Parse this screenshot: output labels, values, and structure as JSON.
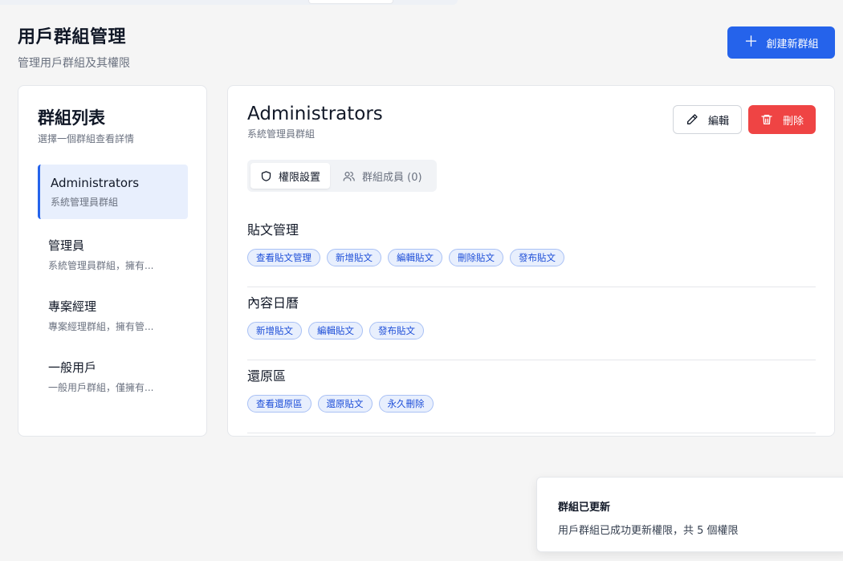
{
  "header": {
    "title": "用戶群組管理",
    "subtitle": "管理用戶群組及其權限",
    "create_label": "創建新群組"
  },
  "group_panel": {
    "title": "群組列表",
    "subtitle": "選擇一個群組查看詳情",
    "items": [
      {
        "name": "Administrators",
        "desc": "系統管理員群組",
        "active": true
      },
      {
        "name": "管理員",
        "desc": "系統管理員群組，擁有..."
      },
      {
        "name": "專案經理",
        "desc": "專案經理群組，擁有管..."
      },
      {
        "name": "一般用戶",
        "desc": "一般用戶群組，僅擁有..."
      }
    ]
  },
  "detail": {
    "title": "Administrators",
    "subtitle": "系統管理員群組",
    "edit_label": "編輯",
    "delete_label": "刪除",
    "tabs": [
      {
        "label": "權限設置",
        "icon": "shield-icon",
        "active": true
      },
      {
        "label": "群組成員 (0)",
        "icon": "users-icon"
      }
    ],
    "sections": [
      {
        "title": "貼文管理",
        "permissions": [
          "查看貼文管理",
          "新增貼文",
          "編輯貼文",
          "刪除貼文",
          "發布貼文"
        ]
      },
      {
        "title": "內容日曆",
        "permissions": [
          "新增貼文",
          "編輯貼文",
          "發布貼文"
        ]
      },
      {
        "title": "還原區",
        "permissions": [
          "查看還原區",
          "還原貼文",
          "永久刪除"
        ]
      }
    ]
  },
  "toast": {
    "title": "群組已更新",
    "message": "用戶群組已成功更新權限，共 5 個權限"
  },
  "colors": {
    "primary": "#2563eb",
    "danger": "#ef4444",
    "chip_bg": "#e8effd",
    "chip_text": "#1d4ed8"
  }
}
